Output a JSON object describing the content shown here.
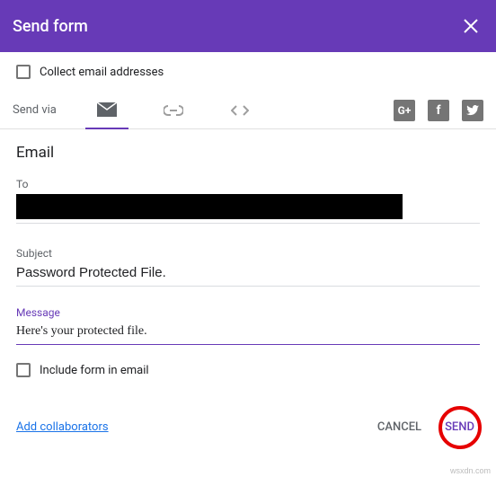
{
  "header": {
    "title": "Send form"
  },
  "collect": {
    "label": "Collect email addresses"
  },
  "sendvia": {
    "label": "Send via"
  },
  "section": {
    "title": "Email"
  },
  "to": {
    "label": "To",
    "value": ""
  },
  "subject": {
    "label": "Subject",
    "value": "Password Protected File."
  },
  "message": {
    "label": "Message",
    "value": "Here's your protected file."
  },
  "include": {
    "label": "Include form in email"
  },
  "footer": {
    "add_collab": "Add collaborators",
    "cancel": "CANCEL",
    "send": "SEND"
  },
  "watermark": "wsxdn.com"
}
